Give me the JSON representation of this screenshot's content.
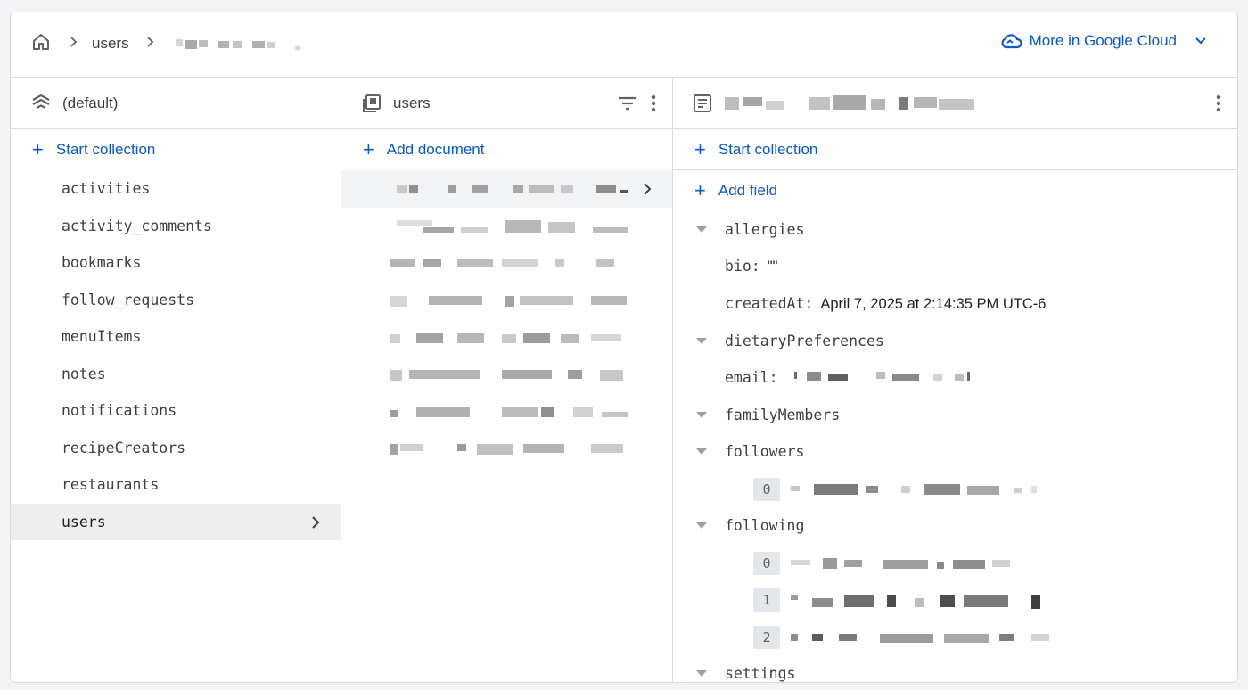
{
  "breadcrumb": {
    "home_icon": "home-icon",
    "collection": "users"
  },
  "header": {
    "gcloud_label": "More in Google Cloud",
    "gcloud_icon": "cloud-icon",
    "accent": "#0b57d0"
  },
  "database_panel": {
    "title": "(default)",
    "icon": "database-stack-icon",
    "start_collection": "Start collection",
    "collections": [
      "activities",
      "activity_comments",
      "bookmarks",
      "follow_requests",
      "menuItems",
      "notes",
      "notifications",
      "recipeCreators",
      "restaurants",
      "users"
    ],
    "selected_collection": "users"
  },
  "collection_panel": {
    "title": "users",
    "icon": "collection-icon",
    "add_document": "Add document"
  },
  "document_panel": {
    "icon": "document-icon",
    "start_collection": "Start collection",
    "add_field": "Add field",
    "fields": {
      "allergies": "allergies",
      "bio_key": "bio:",
      "bio_val": "\"\"",
      "createdAt_key": "createdAt:",
      "createdAt_val": "April 7, 2025 at 2:14:35 PM UTC-6",
      "dietaryPreferences": "dietaryPreferences",
      "email_key": "email:",
      "familyMembers": "familyMembers",
      "followers": "followers",
      "followers_idx": [
        "0"
      ],
      "following": "following",
      "following_idx": [
        "0",
        "1",
        "2"
      ],
      "settings": "settings"
    }
  }
}
